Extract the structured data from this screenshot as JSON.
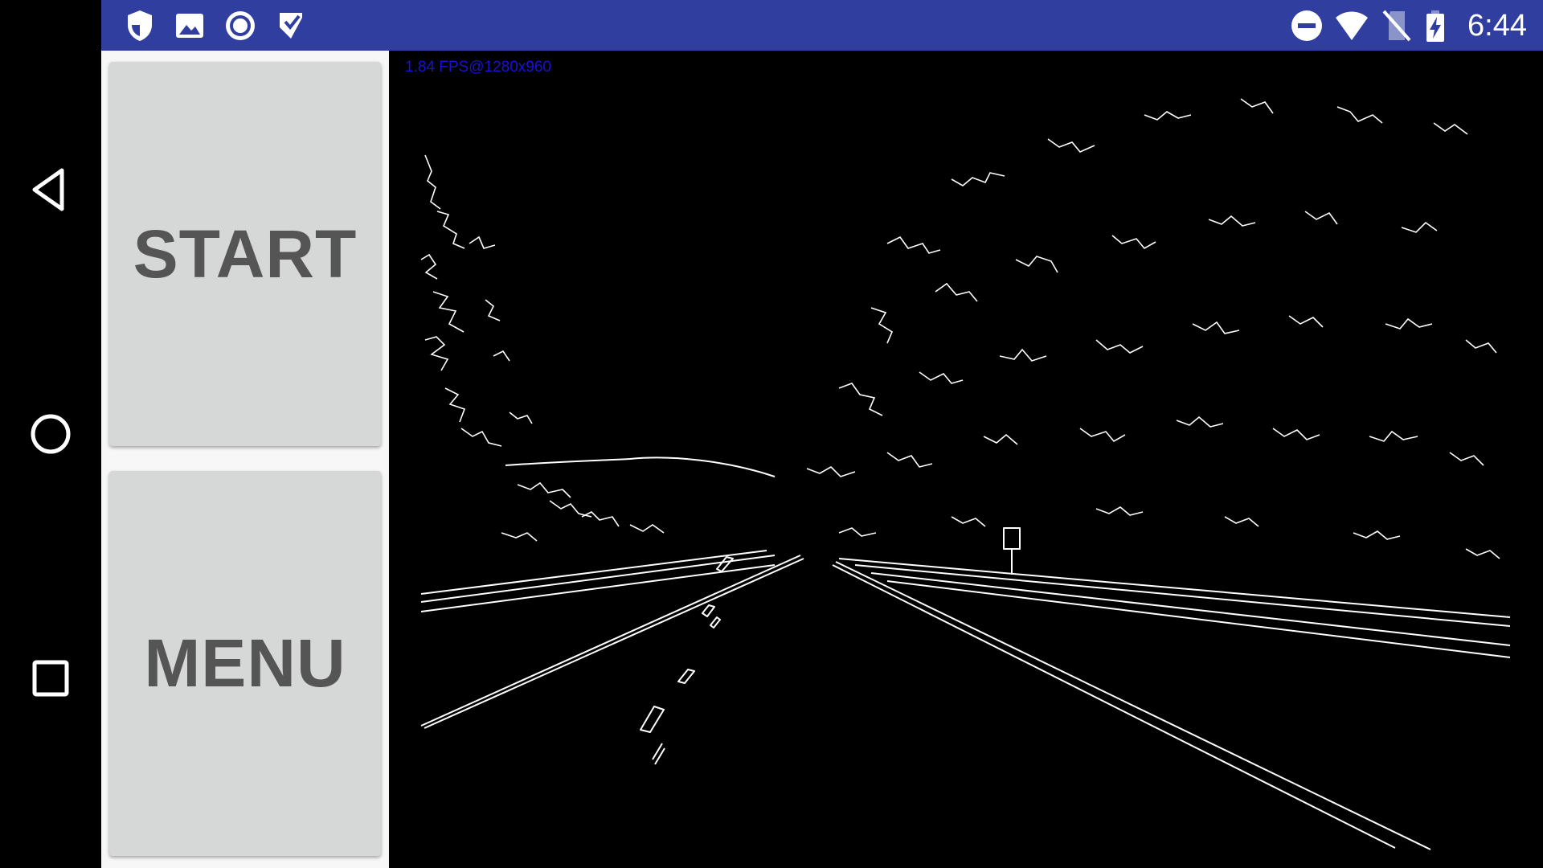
{
  "navigation": {
    "back_icon": "back-triangle-icon",
    "home_icon": "home-circle-icon",
    "recents_icon": "recents-square-icon"
  },
  "status_bar": {
    "time": "6:44",
    "color": "#303f9f",
    "left_icons": [
      "shield-icon",
      "image-icon",
      "record-icon",
      "task-check-icon"
    ],
    "right_icons": [
      "do-not-disturb-icon",
      "wifi-icon",
      "no-sim-icon",
      "battery-charging-icon"
    ]
  },
  "controls": {
    "start_label": "START",
    "menu_label": "MENU"
  },
  "camera_view": {
    "fps_text": "1.84 FPS@1280x960",
    "mode": "edge-detection"
  }
}
